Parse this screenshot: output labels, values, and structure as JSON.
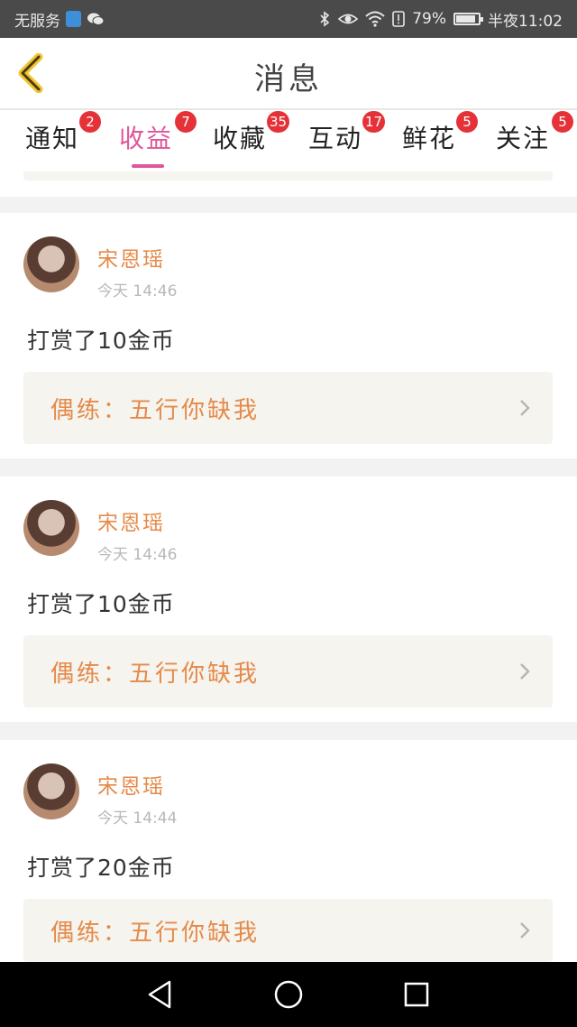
{
  "status_bar": {
    "carrier": "无服务",
    "battery_percent": "79%",
    "battery_level": 0.79,
    "time": "半夜11:02"
  },
  "header": {
    "title": "消息"
  },
  "tabs": [
    {
      "label": "通知",
      "badge": "2"
    },
    {
      "label": "收益",
      "badge": "7",
      "active": true
    },
    {
      "label": "收藏",
      "badge": "35"
    },
    {
      "label": "互动",
      "badge": "17"
    },
    {
      "label": "鲜花",
      "badge": "5"
    },
    {
      "label": "关注",
      "badge": "5"
    }
  ],
  "messages": [
    {
      "name": "宋恩瑶",
      "time": "今天  14:46",
      "text": "打赏了10金币",
      "link": "偶练：五行你缺我"
    },
    {
      "name": "宋恩瑶",
      "time": "今天  14:46",
      "text": "打赏了10金币",
      "link": "偶练：五行你缺我"
    },
    {
      "name": "宋恩瑶",
      "time": "今天  14:44",
      "text": "打赏了20金币",
      "link": "偶练：五行你缺我"
    }
  ],
  "colors": {
    "accent": "#e0569a",
    "name": "#e58a4a",
    "badge": "#e53238"
  }
}
